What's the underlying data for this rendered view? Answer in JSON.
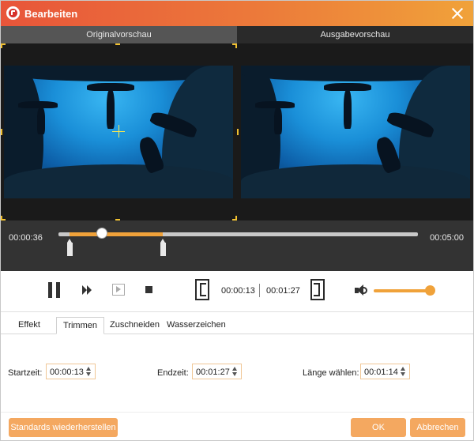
{
  "window": {
    "title": "Bearbeiten"
  },
  "preview": {
    "original_label": "Originalvorschau",
    "output_label": "Ausgabevorschau"
  },
  "timeline": {
    "current_time": "00:00:36",
    "total_time": "00:05:00",
    "progress_fraction": 0.12,
    "trim_start_fraction": 0.03,
    "trim_end_fraction": 0.29
  },
  "controls": {
    "trim_start_time": "00:00:13",
    "trim_end_time": "00:01:27",
    "volume_fraction": 1.0
  },
  "tabs": [
    {
      "label": "Effekt",
      "active": false
    },
    {
      "label": "Trimmen",
      "active": true
    },
    {
      "label": "Zuschneiden",
      "active": false
    },
    {
      "label": "Wasserzeichen",
      "active": false
    }
  ],
  "fields": {
    "start_label": "Startzeit:",
    "start_value": "00:00:13",
    "end_label": "Endzeit:",
    "end_value": "00:01:27",
    "length_label": "Länge wählen:",
    "length_value": "00:01:14"
  },
  "footer": {
    "reset_label": "Standards wiederherstellen",
    "ok_label": "OK",
    "cancel_label": "Abbrechen"
  },
  "colors": {
    "accent": "#f0a23a",
    "title_gradient_start": "#e8553a",
    "button": "#f4a860"
  }
}
